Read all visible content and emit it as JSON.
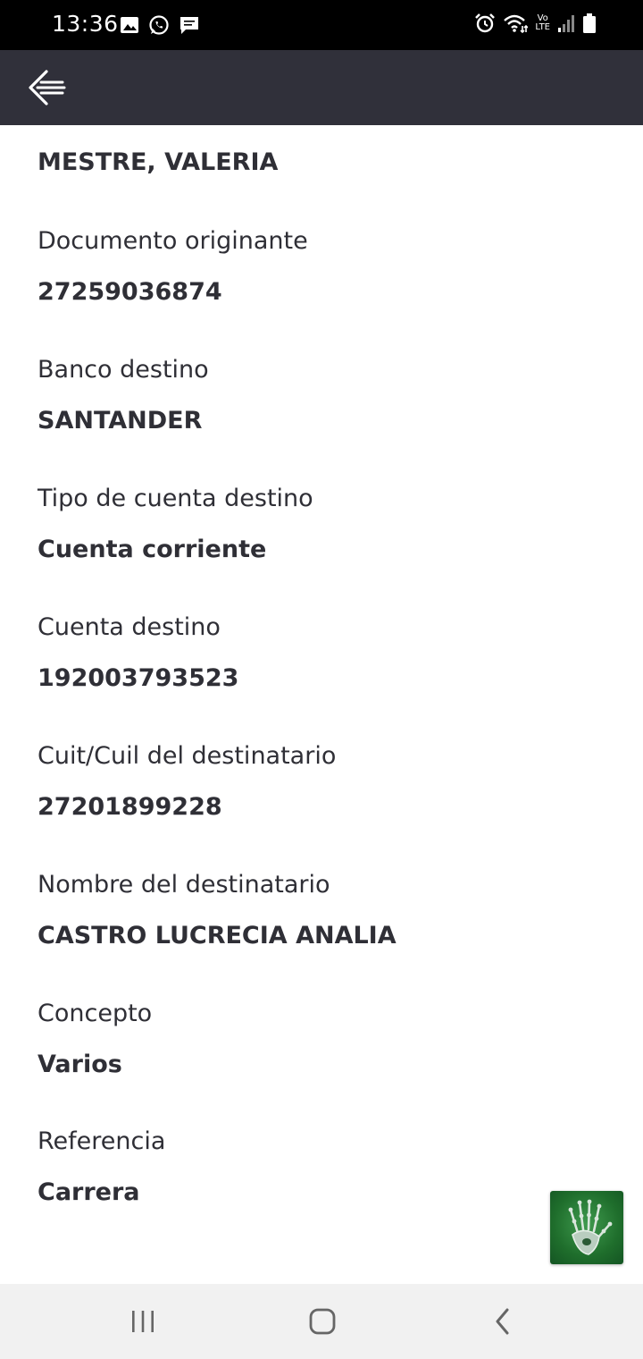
{
  "status_bar": {
    "time": "13:36",
    "left_icons": [
      "image-icon",
      "whatsapp-icon",
      "message-icon"
    ],
    "right_icons": [
      "alarm-icon",
      "wifi-icon",
      "volte-icon",
      "signal-icon",
      "battery-icon"
    ],
    "volte_top": "Vo",
    "volte_bottom": "LTE"
  },
  "app_bar": {
    "back_icon": "back-arrow-icon"
  },
  "details": {
    "originator_name": "MESTRE, VALERIA",
    "fields": [
      {
        "label": "Documento originante",
        "value": "27259036874"
      },
      {
        "label": "Banco destino",
        "value": "SANTANDER"
      },
      {
        "label": "Tipo de cuenta destino",
        "value": "Cuenta corriente"
      },
      {
        "label": "Cuenta destino",
        "value": "192003793523"
      },
      {
        "label": "Cuit/Cuil del destinatario",
        "value": "27201899228"
      },
      {
        "label": "Nombre del destinatario",
        "value": "CASTRO LUCRECIA ANALIA"
      },
      {
        "label": "Concepto",
        "value": "Varios"
      },
      {
        "label": "Referencia",
        "value": "Carrera"
      }
    ]
  },
  "fab": {
    "icon": "robot-hand-icon"
  },
  "nav_bar": {
    "recents_icon": "recents-icon",
    "home_icon": "home-icon",
    "back_icon": "nav-back-icon"
  },
  "colors": {
    "status_bar": "#000000",
    "app_bar": "#30303a",
    "text": "#2f2f36",
    "nav_bar": "#f1f1f1",
    "fab_green": "#1f6e2c"
  }
}
